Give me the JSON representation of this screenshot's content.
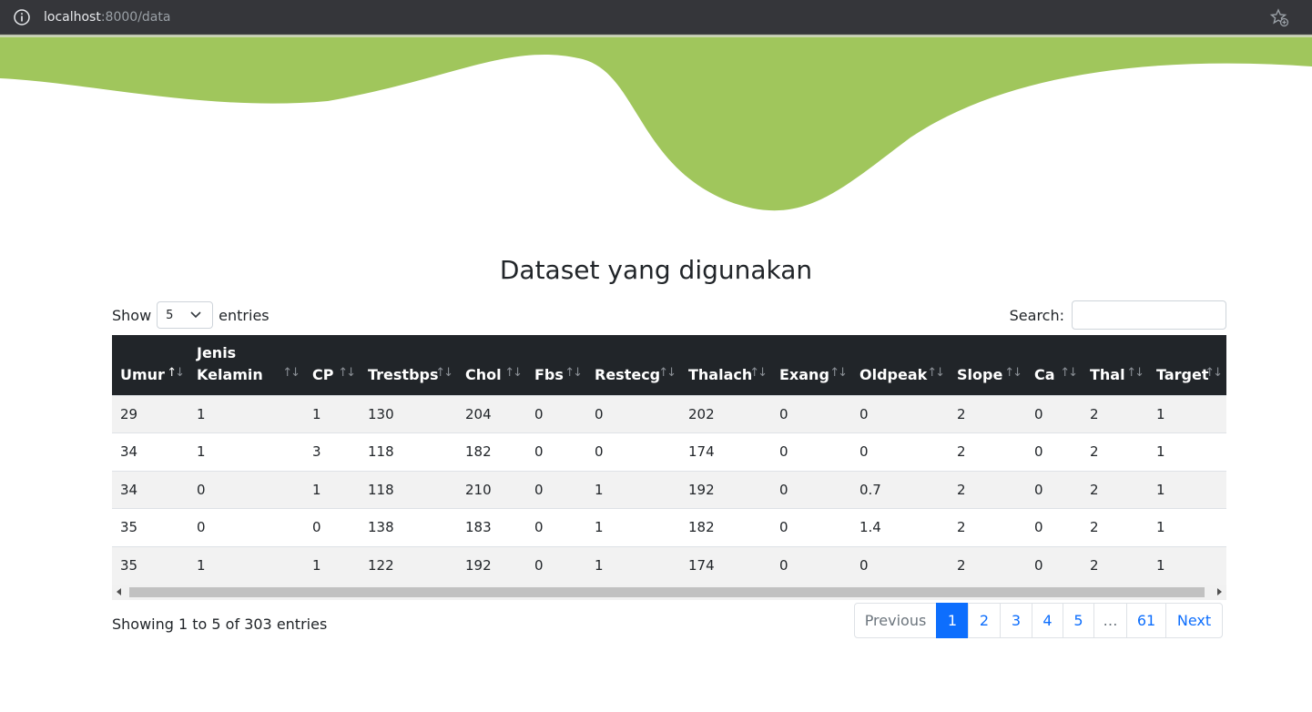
{
  "browser": {
    "url_host": "localhost",
    "url_path": ":8000/data"
  },
  "colors": {
    "wave": "#a0c65c",
    "header_bg": "#212529",
    "accent": "#0d6efd"
  },
  "page": {
    "title": "Dataset yang digunakan"
  },
  "controls": {
    "show_label": "Show",
    "length_value": "5",
    "entries_label": "entries",
    "search_label": "Search:",
    "search_value": ""
  },
  "table": {
    "columns": [
      "Umur",
      "Jenis Kelamin",
      "CP",
      "Trestbps",
      "Chol",
      "Fbs",
      "Restecg",
      "Thalach",
      "Exang",
      "Oldpeak",
      "Slope",
      "Ca",
      "Thal",
      "Target"
    ],
    "sorted_column": "Umur",
    "rows": [
      [
        "29",
        "1",
        "1",
        "130",
        "204",
        "0",
        "0",
        "202",
        "0",
        "0",
        "2",
        "0",
        "2",
        "1"
      ],
      [
        "34",
        "1",
        "3",
        "118",
        "182",
        "0",
        "0",
        "174",
        "0",
        "0",
        "2",
        "0",
        "2",
        "1"
      ],
      [
        "34",
        "0",
        "1",
        "118",
        "210",
        "0",
        "1",
        "192",
        "0",
        "0.7",
        "2",
        "0",
        "2",
        "1"
      ],
      [
        "35",
        "0",
        "0",
        "138",
        "183",
        "0",
        "1",
        "182",
        "0",
        "1.4",
        "2",
        "0",
        "2",
        "1"
      ],
      [
        "35",
        "1",
        "1",
        "122",
        "192",
        "0",
        "1",
        "174",
        "0",
        "0",
        "2",
        "0",
        "2",
        "1"
      ]
    ]
  },
  "footer": {
    "info": "Showing 1 to 5 of 303 entries"
  },
  "pagination": {
    "previous": "Previous",
    "pages": [
      "1",
      "2",
      "3",
      "4",
      "5",
      "…",
      "61"
    ],
    "active_page": "1",
    "next": "Next"
  }
}
